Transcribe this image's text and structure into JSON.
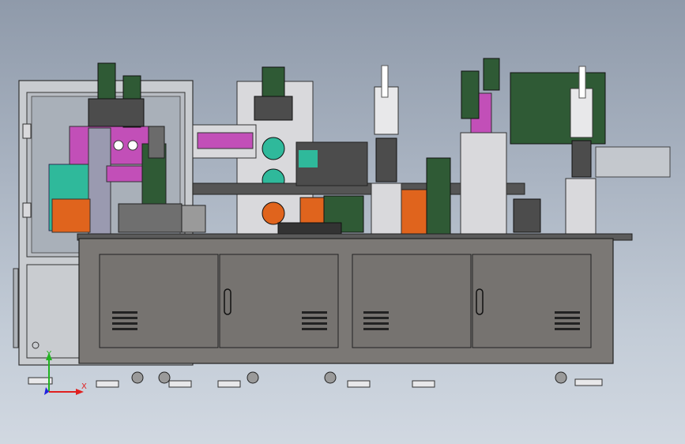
{
  "viewport": {
    "background_top": "#8f9aaa",
    "background_bottom": "#d1d8e1"
  },
  "model": {
    "frame_color": "#6d6a66",
    "cabinet_color": "#7b7875",
    "guard_color": "#c9ccd0",
    "accent_colors": {
      "magenta": "#c24fb8",
      "teal": "#2fb99b",
      "orange": "#e0641d",
      "dark_green": "#2f5a35",
      "light_gray": "#d9d9dc"
    }
  },
  "triad": {
    "x_label": "X",
    "y_label": "Y",
    "x_color": "#e02020",
    "y_color": "#22b322",
    "z_color": "#2020e0"
  }
}
